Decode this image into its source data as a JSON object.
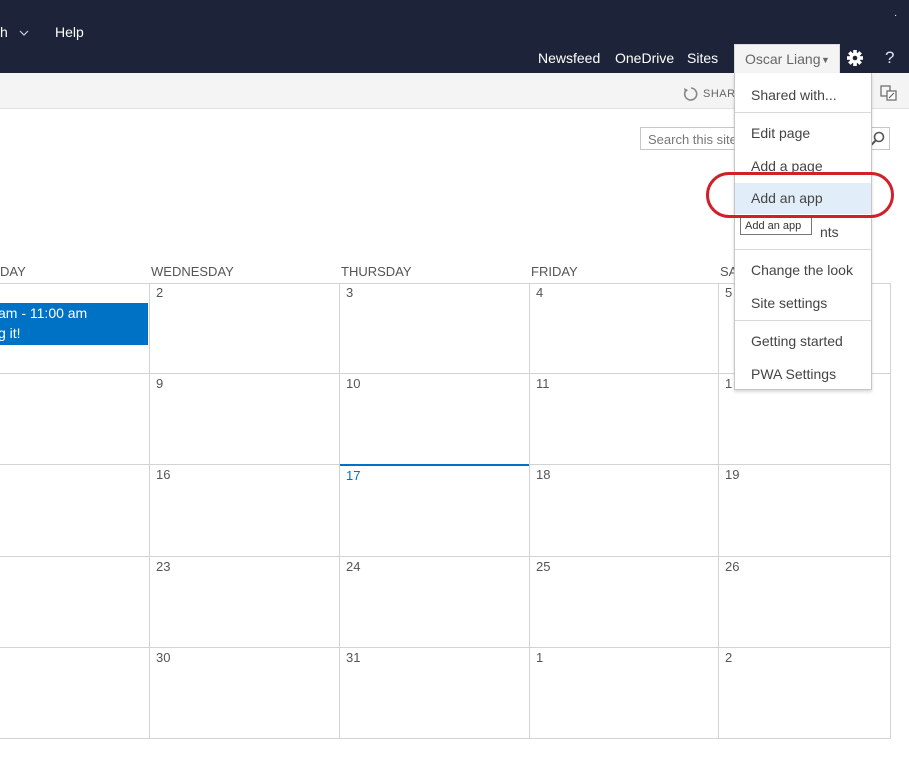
{
  "topnav": {
    "left_item": "h",
    "help": "Help",
    "links": [
      "Newsfeed",
      "OneDrive",
      "Sites"
    ],
    "user": "Oscar Liang",
    "help_icon": "?",
    "dot": "."
  },
  "ribbon": {
    "share_label": "SHAR"
  },
  "search": {
    "placeholder": "Search this site"
  },
  "calendar": {
    "day_headers": [
      "DAY",
      "WEDNESDAY",
      "THURSDAY",
      "FRIDAY",
      "SA"
    ],
    "weeks": [
      [
        "2",
        "3",
        "4",
        "5"
      ],
      [
        "9",
        "10",
        "11",
        "1"
      ],
      [
        "16",
        "17",
        "18",
        "19"
      ],
      [
        "23",
        "24",
        "25",
        "26"
      ],
      [
        "30",
        "31",
        "1",
        "2"
      ]
    ],
    "today": "17",
    "event": {
      "line1": "am - 11:00 am",
      "line2": "g it!"
    },
    "colors": {
      "event": "#0072c6",
      "today": "#0072c6"
    }
  },
  "settings_menu": {
    "items": [
      "Shared with...",
      "Edit page",
      "Add a page",
      "Add an app",
      "nts",
      "Change the look",
      "Site settings",
      "Getting started",
      "PWA Settings"
    ],
    "highlighted": "Add an app",
    "tooltip": "Add an app"
  },
  "icons": {
    "gear": "gear-icon",
    "help": "help-icon",
    "sync": "sync-icon",
    "focus": "focus-on-content-icon",
    "search": "search-icon",
    "chevron": "chevron-down-icon"
  }
}
